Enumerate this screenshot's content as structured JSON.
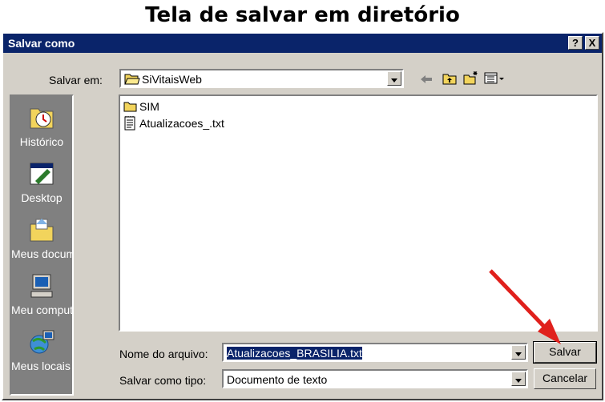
{
  "page_title": "Tela de salvar em diretório",
  "dialog": {
    "title": "Salvar como",
    "help_label": "?",
    "close_label": "X",
    "save_in_label": "Salvar em:",
    "save_in_value": "SiVitaisWeb",
    "places": [
      {
        "label": "Histórico",
        "icon": "history-icon"
      },
      {
        "label": "Desktop",
        "icon": "desktop-icon"
      },
      {
        "label": "Meus docume...",
        "icon": "my-documents-icon"
      },
      {
        "label": "Meu computa...",
        "icon": "my-computer-icon"
      },
      {
        "label": "Meus locais d...",
        "icon": "network-places-icon"
      }
    ],
    "files": [
      {
        "name": "SIM",
        "type": "folder"
      },
      {
        "name": "Atualizacoes_.txt",
        "type": "text-file"
      }
    ],
    "filename_label": "Nome do arquivo:",
    "filename_value": "Atualizacoes_BRASILIA.txt",
    "filetype_label": "Salvar como tipo:",
    "filetype_value": "Documento de texto",
    "save_button": "Salvar",
    "cancel_button": "Cancelar"
  },
  "colors": {
    "titlebar": "#0a246a",
    "dialog_bg": "#d4d0c8",
    "annotation_arrow": "#e0201c"
  }
}
